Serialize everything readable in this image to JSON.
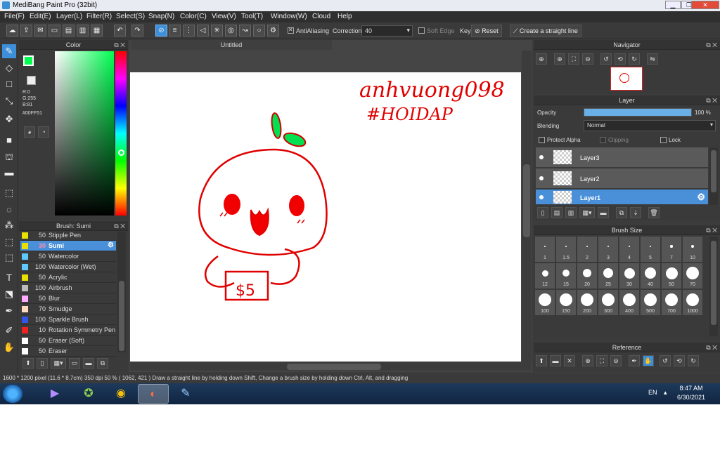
{
  "window": {
    "title": "MediBang Paint Pro (32bit)",
    "min": "▁",
    "max": "❐",
    "close": "✕"
  },
  "menu": [
    "File(F)",
    "Edit(E)",
    "Layer(L)",
    "Filter(R)",
    "Select(S)",
    "Snap(N)",
    "Color(C)",
    "View(V)",
    "Tool(T)",
    "Window(W)",
    "Cloud",
    "Help"
  ],
  "toolbar": {
    "antialiasing_label": "AntiAliasing",
    "correction_label": "Correction",
    "correction_value": "40",
    "soft_edge_label": "Soft Edge",
    "key_label": "Key",
    "reset_label": "Reset",
    "straight_line_label": "Create a straight line"
  },
  "color_panel": {
    "title": "Color",
    "r": "R:0",
    "g": "G:255",
    "b": "B:81",
    "hex": "#00FF51",
    "foreground": "#00ff51"
  },
  "canvas": {
    "tab_title": "Untitled",
    "handwriting_line1": "anhvuong098",
    "handwriting_line2": "#HOIDAP",
    "price_tag": "$5"
  },
  "brush_panel": {
    "title": "Brush: Sumi",
    "items": [
      {
        "size": "50",
        "name": "Stipple Pen",
        "color": "#e8e000"
      },
      {
        "size": "30",
        "name": "Sumi",
        "color": "#e8e000"
      },
      {
        "size": "50",
        "name": "Watercolor",
        "color": "#5fc8ff"
      },
      {
        "size": "100",
        "name": "Watercolor (Wet)",
        "color": "#5fc8ff"
      },
      {
        "size": "50",
        "name": "Acrylic",
        "color": "#e8e000"
      },
      {
        "size": "100",
        "name": "Airbrush",
        "color": "#bbbbbb"
      },
      {
        "size": "50",
        "name": "Blur",
        "color": "#ffaaff"
      },
      {
        "size": "70",
        "name": "Smudge",
        "color": "#ffd9c0"
      },
      {
        "size": "100",
        "name": "Sparkle Brush",
        "color": "#3355ee"
      },
      {
        "size": "10",
        "name": "Rotation Symmetry Pen",
        "color": "#ee2222"
      },
      {
        "size": "50",
        "name": "Eraser (Soft)",
        "color": "#ffffff"
      },
      {
        "size": "50",
        "name": "Eraser",
        "color": "#ffffff"
      }
    ]
  },
  "navigator": {
    "title": "Navigator"
  },
  "layer_panel": {
    "title": "Layer",
    "opacity_label": "Opacity",
    "opacity_value": "100 %",
    "opacity": 1.0,
    "blending_label": "Blending",
    "blending_value": "Normal",
    "protect_alpha_label": "Protect Alpha",
    "clipping_label": "Clipping",
    "lock_label": "Lock",
    "layers": [
      "Layer3",
      "Layer2",
      "Layer1"
    ]
  },
  "brush_size_panel": {
    "title": "Brush Size",
    "sizes": [
      "1",
      "1.5",
      "2",
      "3",
      "4",
      "5",
      "7",
      "10",
      "12",
      "15",
      "20",
      "25",
      "30",
      "40",
      "50",
      "70",
      "100",
      "150",
      "200",
      "300",
      "400",
      "500",
      "700",
      "1000"
    ]
  },
  "reference_panel": {
    "title": "Reference"
  },
  "status": {
    "text": "1600 * 1200 pixel  (11.6 * 8.7cm)  350 dpi  50 %  ( 1062, 421 )  Draw a straight line by holding down Shift, Change a brush size by holding down Ctrl, Alt, and dragging"
  },
  "taskbar": {
    "lang": "EN",
    "time": "8:47 AM",
    "date": "6/30/2021"
  }
}
